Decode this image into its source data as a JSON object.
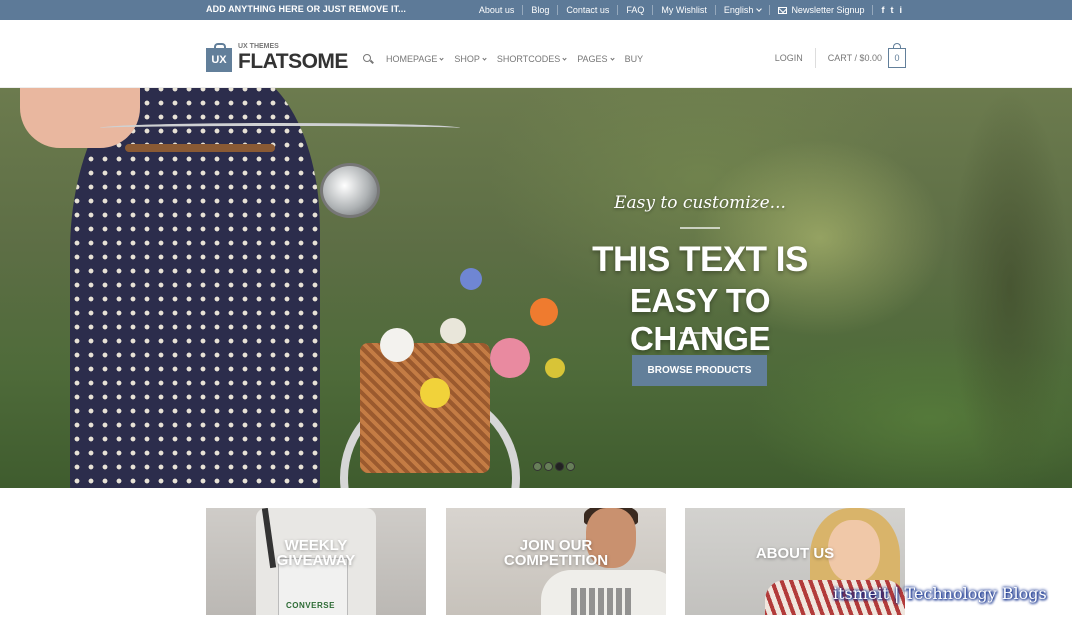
{
  "topbar": {
    "promo_text": "ADD ANYTHING HERE OR JUST REMOVE IT...",
    "links": [
      "About us",
      "Blog",
      "Contact us",
      "FAQ",
      "My Wishlist"
    ],
    "language": "English",
    "newsletter": "Newsletter Signup",
    "social": [
      "f",
      "t",
      "i"
    ],
    "background_color": "#5d7a98"
  },
  "header": {
    "logo_badge": "UX",
    "logo_small": "UX THEMES",
    "logo_main": "FLATSOME",
    "nav": [
      "HOMEPAGE",
      "SHOP",
      "SHORTCODES",
      "PAGES",
      "BUY"
    ],
    "login": "LOGIN",
    "cart": "CART / $0.00",
    "cart_count": "0",
    "accent_color": "#627f9a"
  },
  "hero": {
    "tagline": "Easy to customize...",
    "title_line1": "THIS TEXT IS",
    "title_line2": "EASY TO CHANGE",
    "button": "BROWSE PRODUCTS",
    "slide_dots": 4,
    "active_dot": 3
  },
  "tiles": [
    {
      "line1": "WEEKLY",
      "line2": "GIVEAWAY",
      "brand": "CONVERSE"
    },
    {
      "line1": "JOIN OUR",
      "line2": "COMPETITION"
    },
    {
      "line1": "ABOUT US"
    }
  ],
  "watermark": "itsmeit | Technology Blogs"
}
